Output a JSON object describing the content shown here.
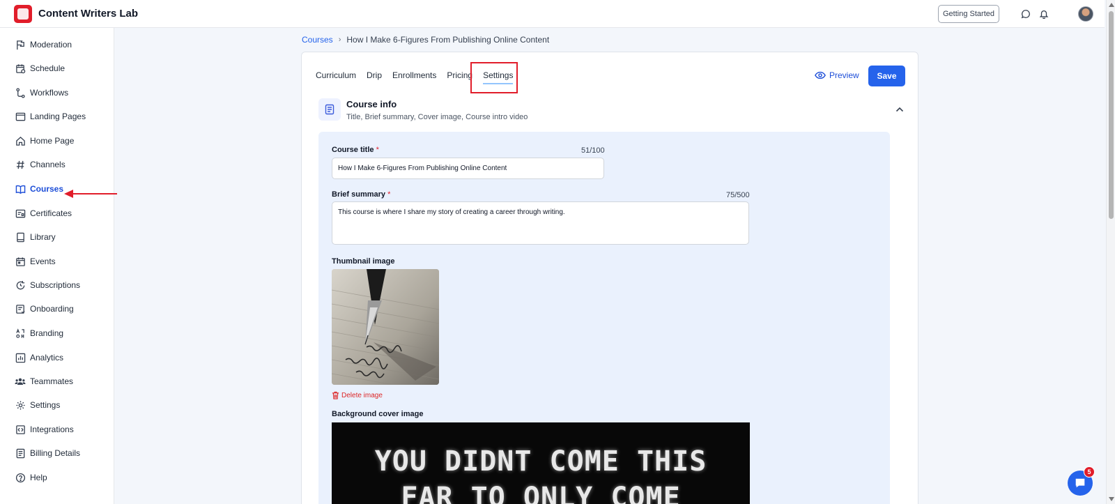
{
  "app": {
    "title": "Content Writers Lab"
  },
  "topbar": {
    "getting_started": "Getting Started"
  },
  "sidebar": {
    "items": [
      {
        "label": "Moderation",
        "icon": "moderation-icon"
      },
      {
        "label": "Schedule",
        "icon": "calendar-clock-icon"
      },
      {
        "label": "Workflows",
        "icon": "workflow-icon"
      },
      {
        "label": "Landing Pages",
        "icon": "window-icon"
      },
      {
        "label": "Home Page",
        "icon": "home-icon"
      },
      {
        "label": "Channels",
        "icon": "hash-icon"
      },
      {
        "label": "Courses",
        "icon": "book-open-icon",
        "active": true
      },
      {
        "label": "Certificates",
        "icon": "certificate-icon"
      },
      {
        "label": "Library",
        "icon": "library-icon"
      },
      {
        "label": "Events",
        "icon": "calendar-icon"
      },
      {
        "label": "Subscriptions",
        "icon": "subscription-icon"
      },
      {
        "label": "Onboarding",
        "icon": "onboarding-icon"
      },
      {
        "label": "Branding",
        "icon": "branding-icon"
      },
      {
        "label": "Analytics",
        "icon": "analytics-icon"
      },
      {
        "label": "Teammates",
        "icon": "team-icon"
      },
      {
        "label": "Settings",
        "icon": "gear-icon"
      },
      {
        "label": "Integrations",
        "icon": "integrations-icon"
      },
      {
        "label": "Billing Details",
        "icon": "billing-icon"
      },
      {
        "label": "Help",
        "icon": "help-icon"
      }
    ]
  },
  "breadcrumb": {
    "root": "Courses",
    "current": "How I Make 6-Figures From Publishing Online Content"
  },
  "tabs": [
    {
      "label": "Curriculum"
    },
    {
      "label": "Drip"
    },
    {
      "label": "Enrollments"
    },
    {
      "label": "Pricing"
    },
    {
      "label": "Settings",
      "active": true
    }
  ],
  "actions": {
    "preview": "Preview",
    "save": "Save"
  },
  "section": {
    "title": "Course info",
    "subtitle": "Title, Brief summary, Cover image, Course intro video"
  },
  "form": {
    "course_title": {
      "label": "Course title",
      "required": "*",
      "counter": "51/100",
      "value": "How I Make 6-Figures From Publishing Online Content"
    },
    "brief_summary": {
      "label": "Brief summary",
      "required": "*",
      "counter": "75/500",
      "value": "This course is where I share my story of creating a career through writing."
    },
    "thumbnail": {
      "label": "Thumbnail image",
      "delete_label": "Delete image"
    },
    "cover": {
      "label": "Background cover image",
      "image_text_line1": "YOU DIDNT COME THIS",
      "image_text_line2": "FAR TO ONLY COME"
    }
  },
  "chat": {
    "badge": "5"
  },
  "colors": {
    "accent": "#2563eb",
    "highlight": "#e11d2a",
    "active_nav": "#1d4ed8"
  }
}
